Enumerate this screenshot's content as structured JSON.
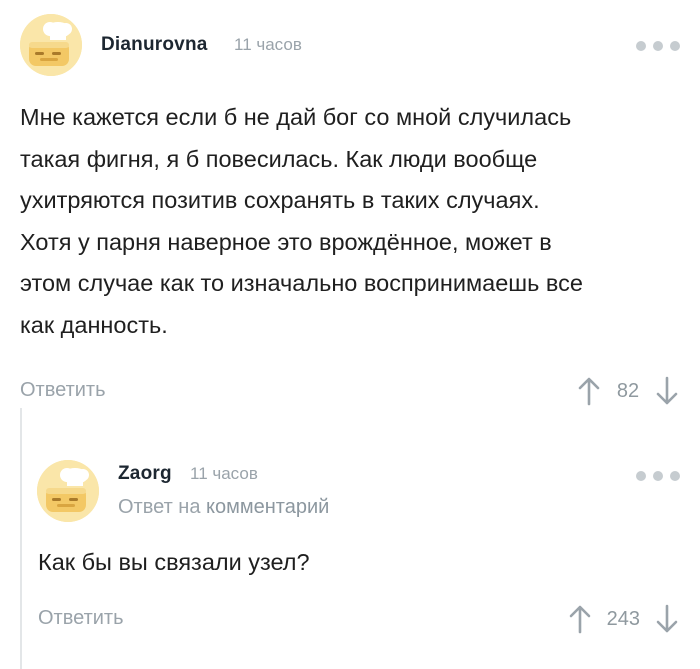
{
  "comments": [
    {
      "author": "Dianurovna",
      "time": "11 часов",
      "lines": [
        "Мне кажется если б не дай бог со мной случилась",
        "такая фигня, я б повесилась. Как люди вообще",
        "ухитряются позитив сохранять в таких случаях.",
        "Хотя у парня наверное это врождённое, может в",
        "этом случае как то изначально воспринимаешь все",
        "как данность."
      ],
      "reply_label": "Ответить",
      "score": "82",
      "avatar_icon": "toaster-chef-icon",
      "more_icon": "more-dots-icon"
    },
    {
      "author": "Zaorg",
      "time": "11 часов",
      "reply_to_prefix": "Ответ на",
      "reply_to_link": "комментарий",
      "lines": [
        "Как бы вы связали узел?"
      ],
      "reply_label": "Ответить",
      "score": "243",
      "avatar_icon": "toaster-chef-icon",
      "more_icon": "more-dots-icon"
    }
  ],
  "colors": {
    "text": "#1f1f1f",
    "author": "#1d2731",
    "muted": "#9aa3aa",
    "avatar_bg": "#fae6a9",
    "dots": "#c6ccd0",
    "thread_line": "#e3e6e8"
  },
  "icons": {
    "upvote": "arrow-up-icon",
    "downvote": "arrow-down-icon"
  }
}
